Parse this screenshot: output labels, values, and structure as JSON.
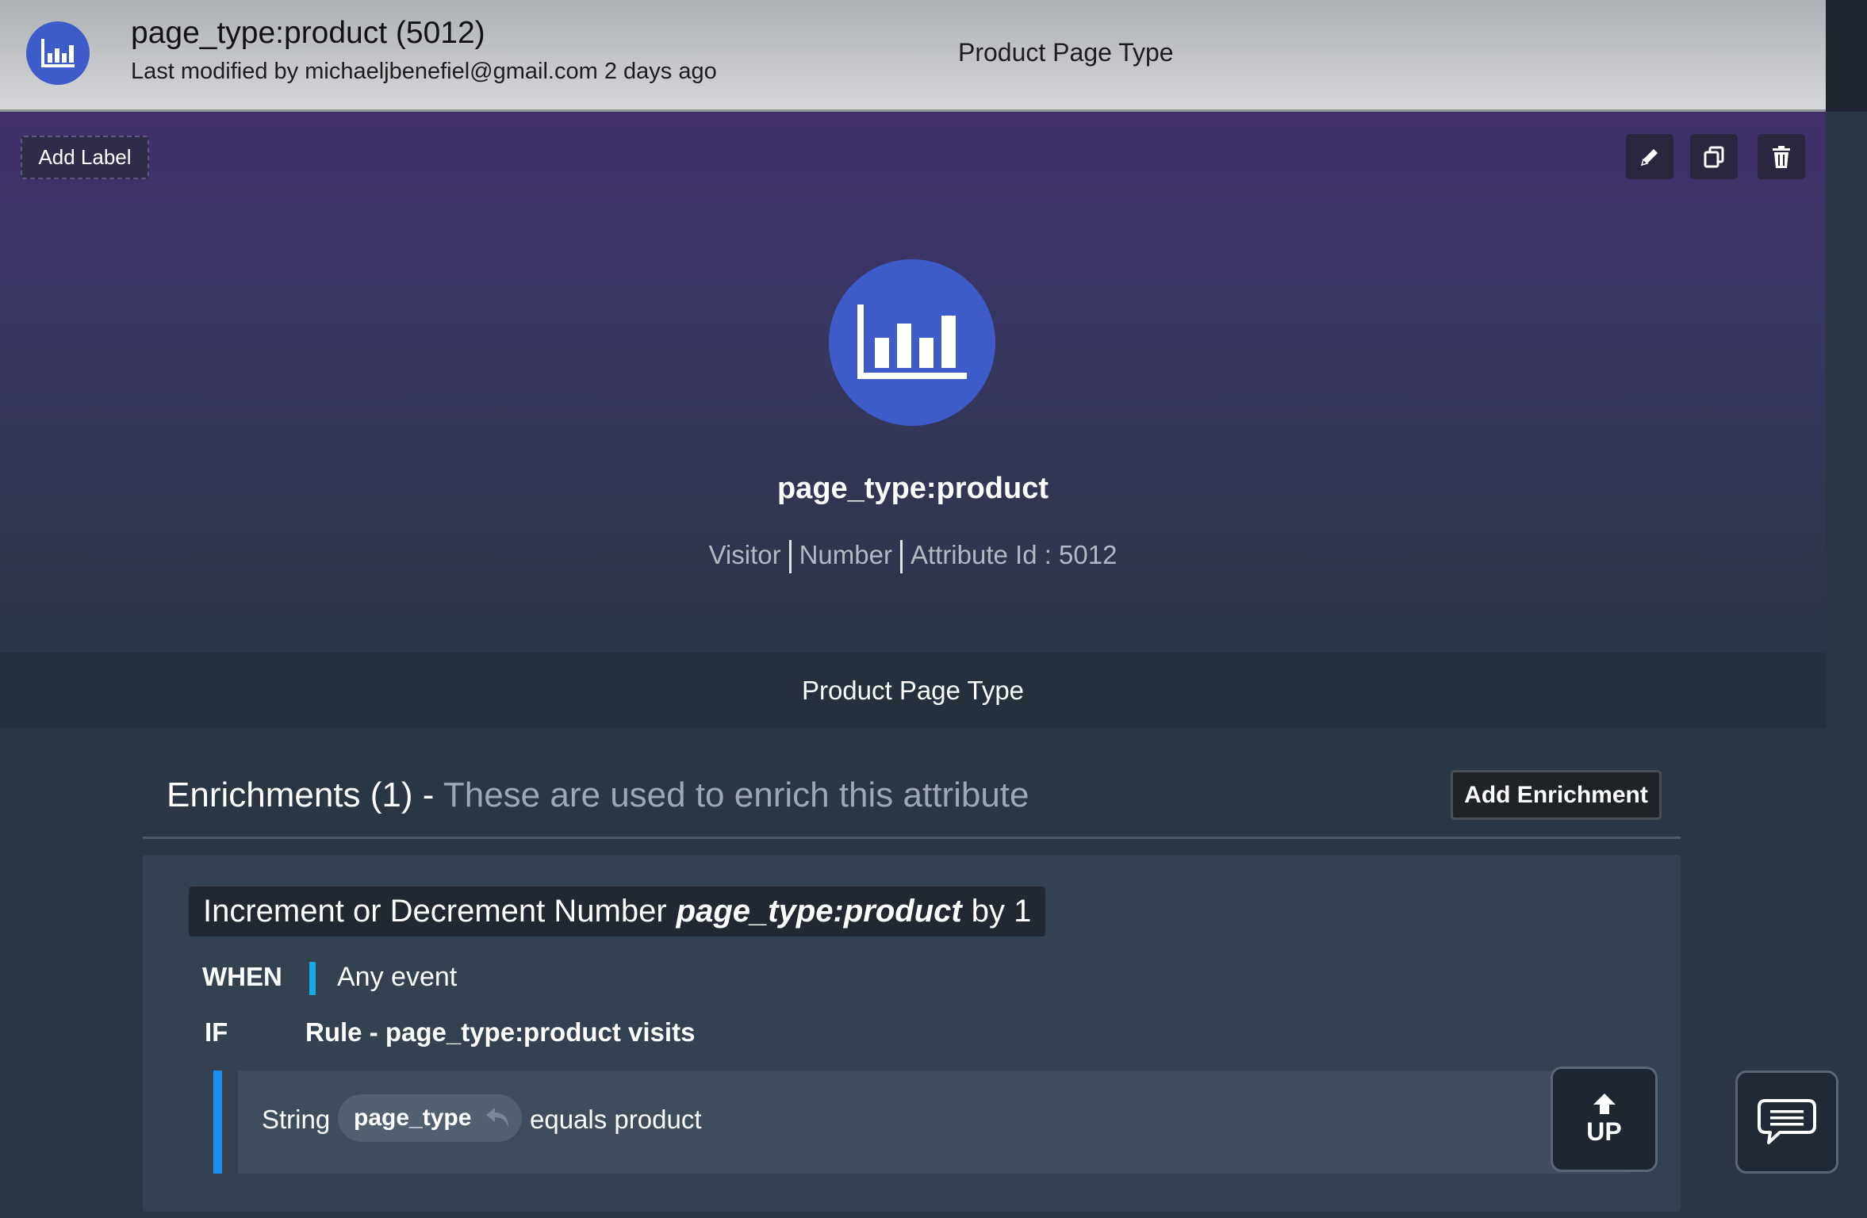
{
  "header": {
    "title": "page_type:product (5012)",
    "subtitle": "Last modified by michaeljbenefiel@gmail.com 2 days ago",
    "center_label": "Product Page Type",
    "icon": "bar-chart-icon"
  },
  "hero": {
    "add_label": "Add Label",
    "tools": [
      "pencil-icon",
      "copy-icon",
      "trash-icon"
    ],
    "icon": "bar-chart-icon",
    "name": "page_type:product",
    "meta": {
      "scope": "Visitor",
      "type": "Number",
      "attribute_id": "Attribute Id : 5012"
    }
  },
  "description": "Product Page Type",
  "enrichments": {
    "title": "Enrichments (1)",
    "dash": " - ",
    "subtitle": "These are used to enrich this attribute",
    "add_button": "Add Enrichment",
    "items": [
      {
        "title_prefix": "Increment or Decrement Number",
        "title_attr": "page_type:product",
        "title_suffix": "by 1",
        "when_label": "WHEN",
        "when_value": "Any event",
        "if_label": "IF",
        "if_value": "Rule - page_type:product visits",
        "condition": {
          "type": "String",
          "variable": "page_type",
          "operator": "equals product"
        }
      }
    ]
  },
  "floating": {
    "up_label": "UP",
    "chat_icon": "chat-bubble-icon"
  },
  "colors": {
    "accent_blue": "#3d5bc9",
    "when_bar": "#19a9e1",
    "condition_bar": "#1a8ff0"
  }
}
